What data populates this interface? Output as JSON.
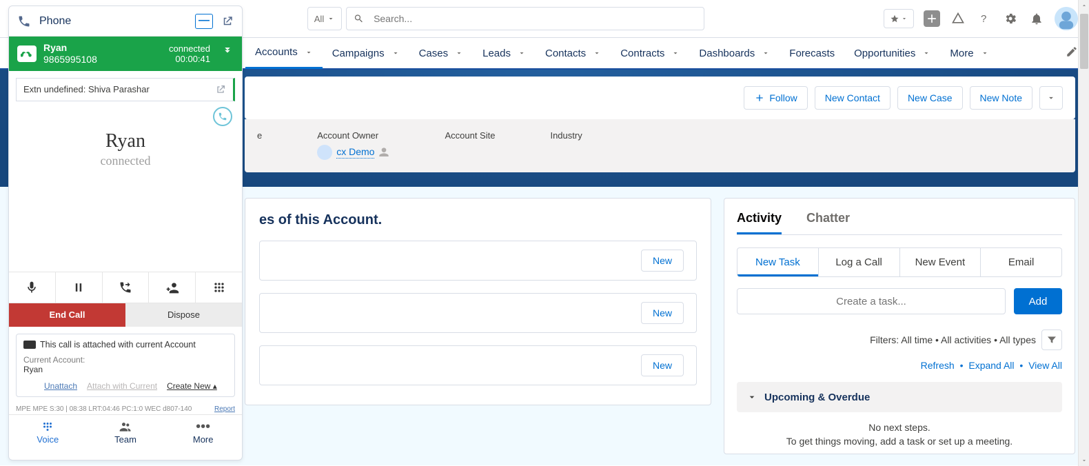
{
  "search": {
    "scope": "All",
    "placeholder": "Search..."
  },
  "nav": {
    "items": [
      "Accounts",
      "Campaigns",
      "Cases",
      "Leads",
      "Contacts",
      "Contracts",
      "Dashboards",
      "Forecasts",
      "Opportunities",
      "More"
    ],
    "active_index": 0
  },
  "record_actions": {
    "follow": "Follow",
    "new_contact": "New Contact",
    "new_case": "New Case",
    "new_note": "New Note"
  },
  "detail_fields": {
    "type_label": "e",
    "owner_label": "Account Owner",
    "owner_value": "cx Demo",
    "site_label": "Account Site",
    "industry_label": "Industry"
  },
  "related": {
    "title_fragment": "es of this Account.",
    "new_label": "New"
  },
  "activity": {
    "tabs": [
      "Activity",
      "Chatter"
    ],
    "sub_tabs": [
      "New Task",
      "Log a Call",
      "New Event",
      "Email"
    ],
    "task_placeholder": "Create a task...",
    "add_label": "Add",
    "filters_text": "Filters: All time • All activities • All types",
    "links": {
      "refresh": "Refresh",
      "expand": "Expand All",
      "view": "View All"
    },
    "upcoming_label": "Upcoming & Overdue",
    "empty": {
      "line1": "No next steps.",
      "line2": "To get things moving, add a task or set up a meeting."
    }
  },
  "cti": {
    "header_title": "Phone",
    "caller_name": "Ryan",
    "caller_number": "9865995108",
    "status": "connected",
    "duration": "00:00:41",
    "ext_line": "Extn undefined: Shiva Parashar",
    "center_name": "Ryan",
    "center_status": "connected",
    "end_call": "End Call",
    "dispose": "Dispose",
    "attach": {
      "headline": "This call is attached with current Account",
      "label": "Current Account:",
      "value": "Ryan"
    },
    "links": {
      "unattach": "Unattach",
      "attach_current": "Attach with Current",
      "create_new": "Create New"
    },
    "footer_readout": "MPE MPE S:30 | 08:38 LRT:04:46 PC:1:0 WEC d807-140",
    "report": "Report",
    "bottom_tabs": [
      "Voice",
      "Team",
      "More"
    ]
  }
}
